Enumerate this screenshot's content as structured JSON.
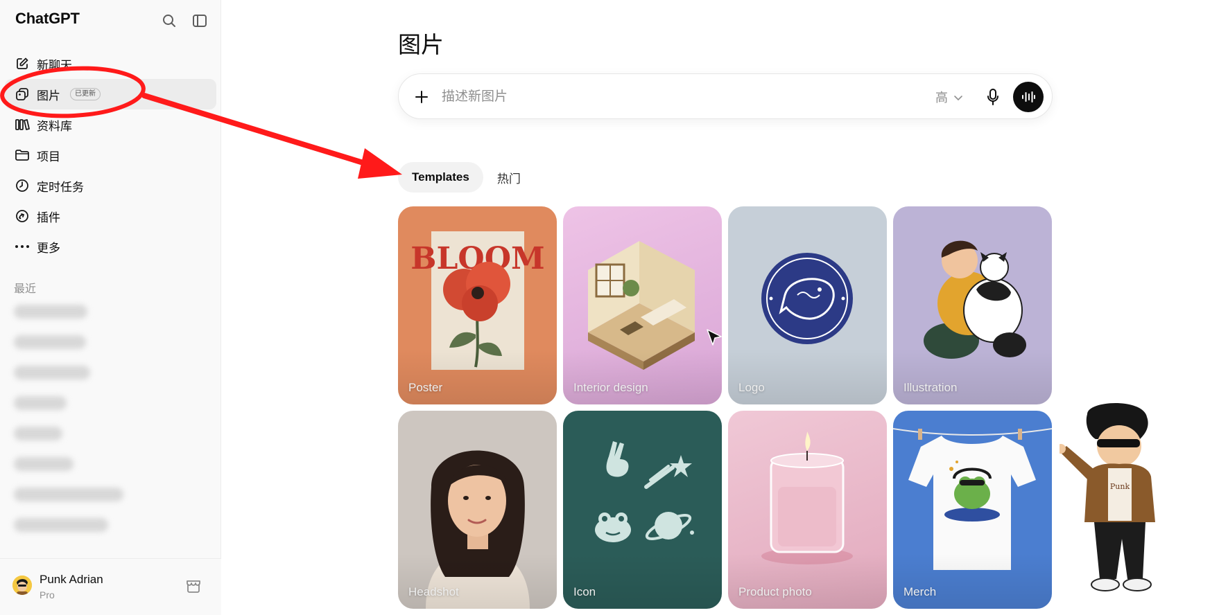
{
  "app": {
    "title": "ChatGPT"
  },
  "sidebar": {
    "items": [
      {
        "label": "新聊天",
        "icon": "new-chat-icon"
      },
      {
        "label": "图片",
        "icon": "images-icon",
        "badge": "已更新",
        "active": true
      },
      {
        "label": "资料库",
        "icon": "library-icon"
      },
      {
        "label": "项目",
        "icon": "folder-icon"
      },
      {
        "label": "定时任务",
        "icon": "clock-icon"
      },
      {
        "label": "插件",
        "icon": "plugin-icon"
      },
      {
        "label": "更多",
        "icon": "more-icon"
      }
    ],
    "recent_label": "最近",
    "user": {
      "name": "Punk Adrian",
      "plan": "Pro"
    }
  },
  "main": {
    "title": "图片",
    "composer": {
      "placeholder": "描述新图片",
      "quality": "高"
    },
    "tabs": [
      {
        "label": "Templates",
        "active": true
      },
      {
        "label": "热门",
        "active": false
      }
    ],
    "cards": [
      {
        "label": "Poster",
        "color": "#e08a5e"
      },
      {
        "label": "Interior design",
        "color": "#e5b6df"
      },
      {
        "label": "Logo",
        "color": "#c6cfd8"
      },
      {
        "label": "Illustration",
        "color": "#bcb3d6"
      },
      {
        "label": "Headshot",
        "color": "#cdc6c0"
      },
      {
        "label": "Icon",
        "color": "#2b5c58"
      },
      {
        "label": "Product photo",
        "color": "#e9b6c7"
      },
      {
        "label": "Merch",
        "color": "#4b7ed0"
      }
    ],
    "poster_text": "BLOOM",
    "mascot_shirt_text": "Punk"
  },
  "colors": {
    "annotation_red": "#ff1a1a",
    "accent_dark": "#0d0d0d"
  }
}
